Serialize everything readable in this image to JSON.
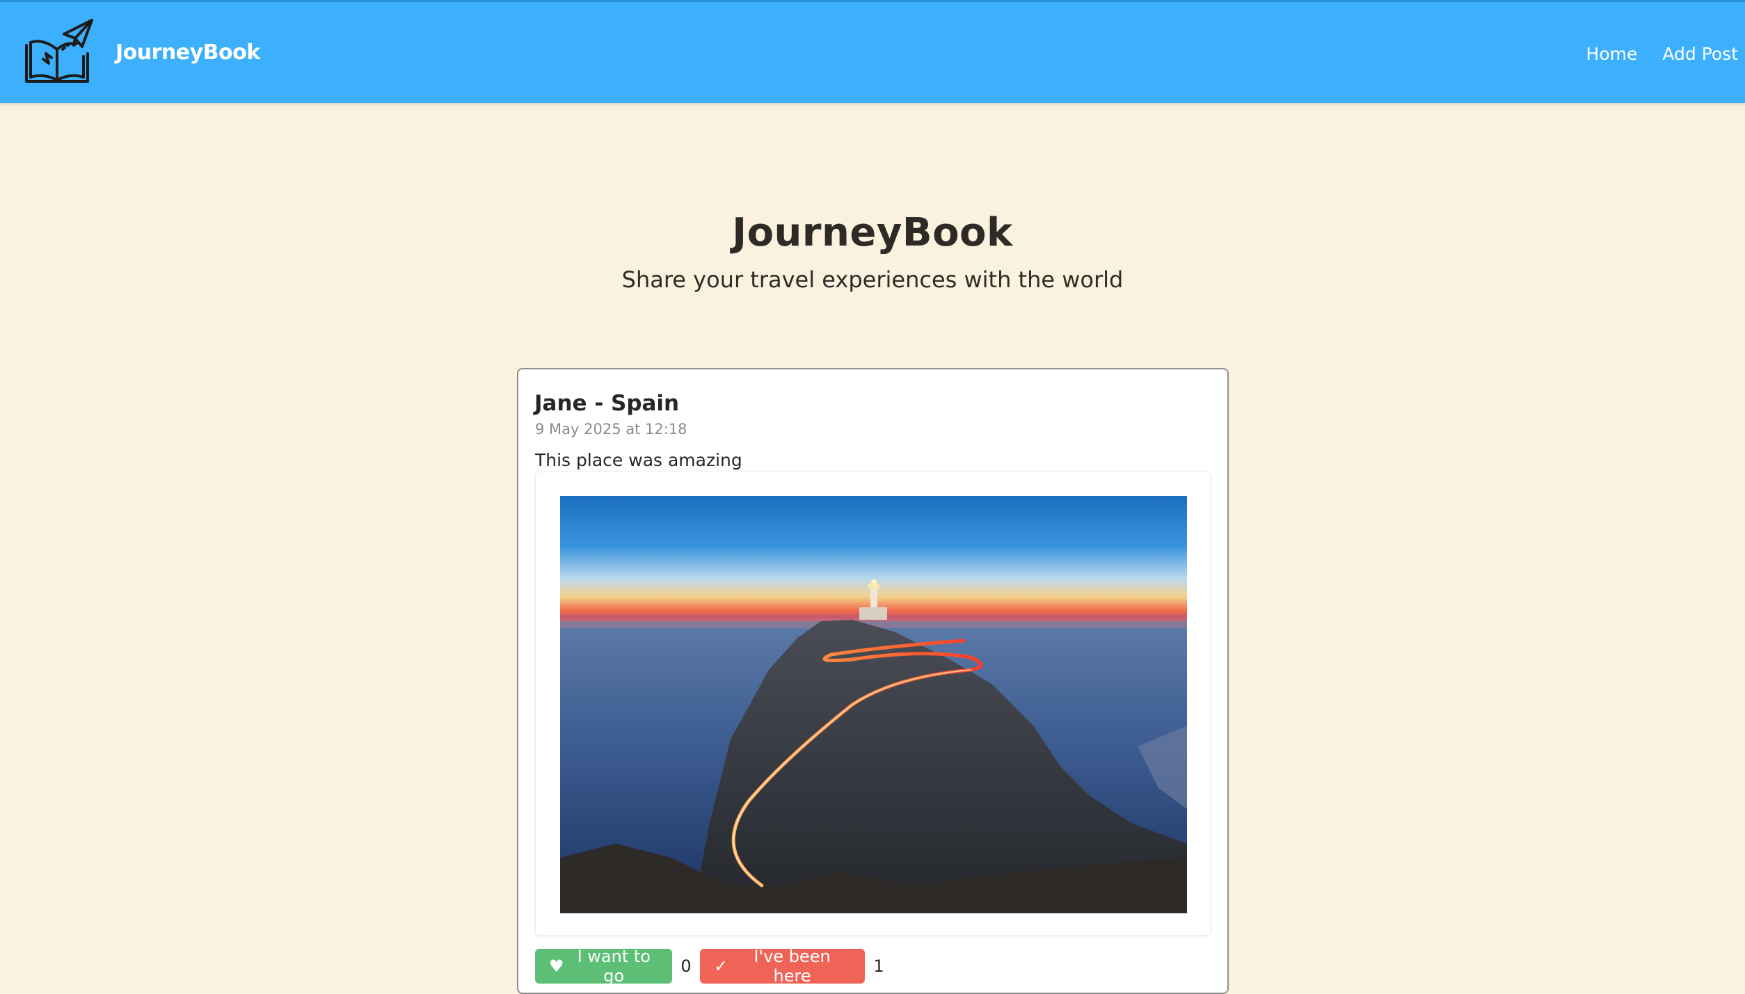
{
  "navbar": {
    "brand": "JourneyBook",
    "logo_icon": "book-paper-plane-icon",
    "links": [
      {
        "label": "Home"
      },
      {
        "label": "Add Post"
      }
    ]
  },
  "hero": {
    "title": "JourneyBook",
    "subtitle": "Share your travel experiences with the world"
  },
  "post": {
    "title": "Jane - Spain",
    "date": "9 May 2025 at 12:18",
    "text": "This place was amazing",
    "want_to_go": {
      "icon": "heart-icon",
      "symbol": "♥",
      "label": "I want to go",
      "count": "0"
    },
    "been_here": {
      "icon": "check-icon",
      "symbol": "✓",
      "label": "I've been here",
      "count": "1"
    }
  },
  "colors": {
    "navbar": "#3db0fd",
    "background": "#faf2df",
    "want_button": "#5cbf75",
    "been_button": "#f06458"
  }
}
